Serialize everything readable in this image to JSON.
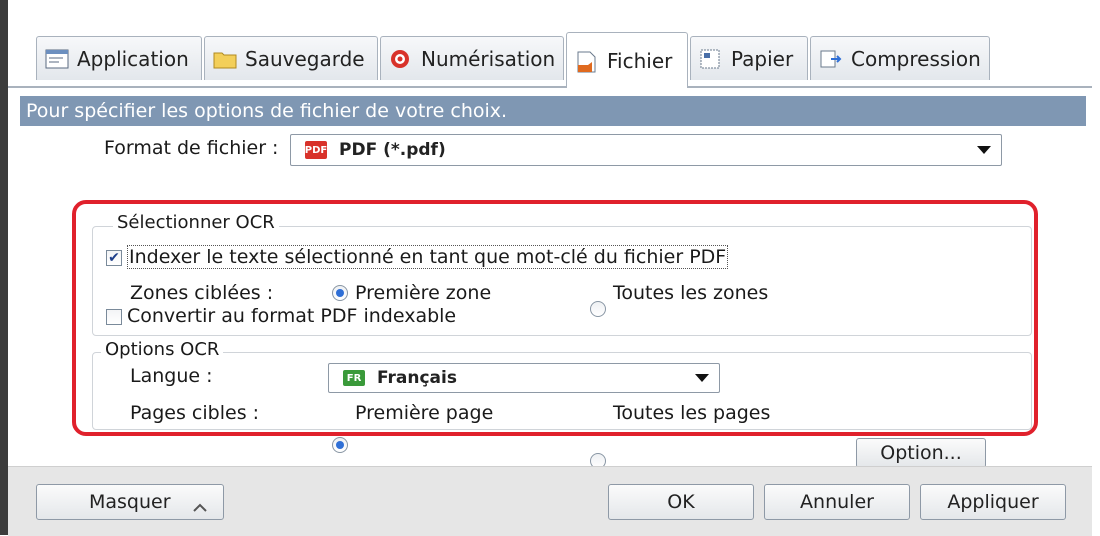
{
  "tabs": [
    {
      "label": "Application",
      "icon": "application-icon"
    },
    {
      "label": "Sauvegarde",
      "icon": "folder-icon"
    },
    {
      "label": "Numérisation",
      "icon": "scan-icon"
    },
    {
      "label": "Fichier",
      "icon": "file-icon",
      "active": true
    },
    {
      "label": "Papier",
      "icon": "paper-icon"
    },
    {
      "label": "Compression",
      "icon": "compression-icon"
    }
  ],
  "info_bar": "Pour spécifier les options de fichier de votre choix.",
  "file_format": {
    "label": "Format de fichier :",
    "badge": "PDF",
    "value": "PDF (*.pdf)"
  },
  "ocr_select": {
    "title": "Sélectionner OCR",
    "index_checkbox": {
      "label": "Indexer le texte sélectionné en tant que mot-clé du fichier PDF",
      "checked": true
    },
    "zones_label": "Zones ciblées :",
    "zone_first": {
      "label": "Première zone",
      "checked": true
    },
    "zone_all": {
      "label": "Toutes les zones",
      "checked": false
    },
    "convert_checkbox": {
      "label": "Convertir au format PDF indexable",
      "checked": false
    }
  },
  "ocr_options": {
    "title": "Options OCR",
    "language_label": "Langue :",
    "language_badge": "FR",
    "language_value": "Français",
    "pages_label": "Pages cibles :",
    "page_first": {
      "label": "Première page",
      "checked": true
    },
    "page_all": {
      "label": "Toutes les pages",
      "checked": false
    }
  },
  "buttons": {
    "option": "Option...",
    "hide": "Masquer",
    "ok": "OK",
    "cancel": "Annuler",
    "apply": "Appliquer"
  },
  "colors": {
    "info_bar": "#7f97b3",
    "highlight": "#e0212c",
    "pdf_badge": "#d8322a",
    "fr_badge": "#3a9a3a"
  }
}
